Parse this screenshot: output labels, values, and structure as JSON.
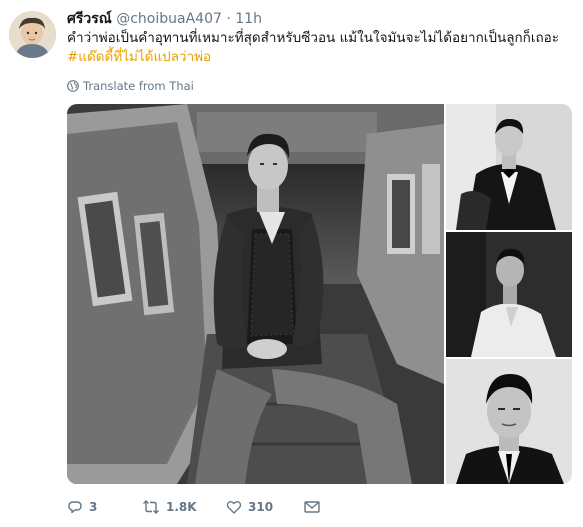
{
  "tweet": {
    "display_name": "ศรีวรณ์",
    "handle": "@choibuaA407",
    "separator": "·",
    "time": "11h",
    "text": "คำว่าพ่อเป็นคำอุทานที่เหมาะที่สุดสำหรับซีวอน แม้ในใจมันจะไม่ได้อยากเป็นลูกก็เถอะ",
    "hashtag": "#แด๊ดดี้ที่ไม่ได้แปลว่าพ่อ",
    "translate_label": "Translate from Thai"
  },
  "actions": {
    "replies": "3",
    "retweets": "1.8K",
    "likes": "310"
  },
  "icons": {
    "reply": "reply-icon",
    "retweet": "retweet-icon",
    "like": "heart-icon",
    "message": "envelope-icon",
    "translate": "globe-icon"
  },
  "colors": {
    "hashtag": "#e8a000",
    "muted": "#657786",
    "text": "#14171a"
  }
}
